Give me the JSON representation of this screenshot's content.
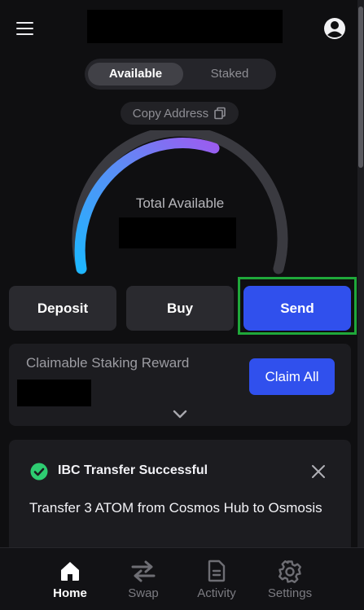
{
  "header": {
    "menu_icon": "hamburger-menu-icon",
    "profile_icon": "user-circle-icon"
  },
  "balance_toggle": {
    "options": [
      "Available",
      "Staked"
    ],
    "selected": "Available"
  },
  "copy_address": {
    "label": "Copy Address",
    "icon": "copy-icon"
  },
  "gauge": {
    "label": "Total Available",
    "gradient_start": "#1eb6ff",
    "gradient_end": "#9b5cf0",
    "track_color": "#3a3a40"
  },
  "actions": {
    "deposit": "Deposit",
    "buy": "Buy",
    "send": "Send"
  },
  "staking_reward": {
    "label": "Claimable Staking Reward",
    "claim_label": "Claim All",
    "expand_icon": "chevron-down-icon"
  },
  "notification": {
    "title": "IBC Transfer Successful",
    "message": "Transfer 3 ATOM from Cosmos Hub to Osmosis",
    "status_icon": "check-circle-icon",
    "close_icon": "close-icon",
    "status_color": "#2ecc71"
  },
  "bottom_nav": {
    "items": [
      {
        "label": "Home",
        "icon": "home-icon"
      },
      {
        "label": "Swap",
        "icon": "swap-arrows-icon"
      },
      {
        "label": "Activity",
        "icon": "document-icon"
      },
      {
        "label": "Settings",
        "icon": "gear-icon"
      }
    ],
    "active": "Home"
  },
  "colors": {
    "accent": "#3050ed",
    "highlight_outline": "#1fa83a",
    "background": "#0f0f11"
  }
}
